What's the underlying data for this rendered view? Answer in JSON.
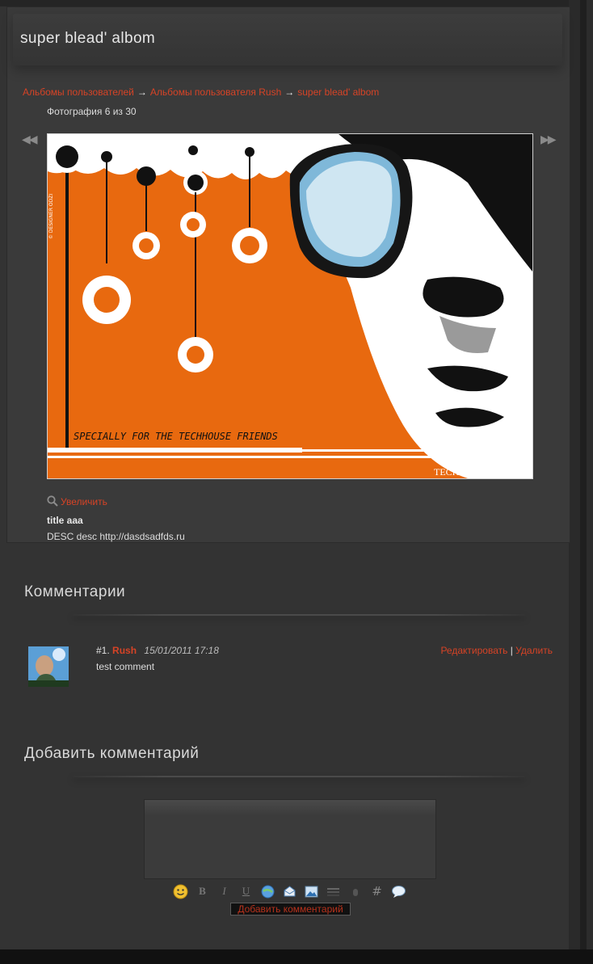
{
  "album": {
    "title": "super blead' albom",
    "breadcrumb": [
      {
        "label": "Альбомы пользователей"
      },
      {
        "label": "Альбомы пользователя Rush"
      },
      {
        "label": "super blead' albom"
      }
    ],
    "breadcrumb_separator": "→",
    "photo_counter": "Фотография 6 из 30",
    "nav_prev": "◀◀",
    "nav_next": "▶▶"
  },
  "photo": {
    "caption_art": "SPECIALLY FOR THE TECHHOUSE FRIENDS",
    "watermark": "TECHHOUSE.EE",
    "designer_mark": "© DESIGNER ODZI",
    "zoom_label": "Увеличить",
    "title": "title aaa",
    "description": "DESC desc http://dasdsadfds.ru"
  },
  "comments": {
    "heading": "Комментарии",
    "items": [
      {
        "number": "#1.",
        "author": "Rush",
        "date": "15/01/2011 17:18",
        "text": "test comment",
        "edit_label": "Редактировать",
        "action_sep": "|",
        "delete_label": "Удалить"
      }
    ]
  },
  "add_comment": {
    "heading": "Добавить комментарий",
    "textarea_value": "",
    "submit_label": "Добавить комментарий",
    "toolbar": [
      "smiley-icon",
      "bold-icon",
      "italic-icon",
      "underline-icon",
      "link-icon",
      "email-icon",
      "image-icon",
      "quote-icon",
      "spoiler-icon",
      "code-icon",
      "chat-icon"
    ]
  },
  "colors": {
    "link": "#d64326",
    "background": "#333333",
    "photo_orange": "#e8690f"
  }
}
